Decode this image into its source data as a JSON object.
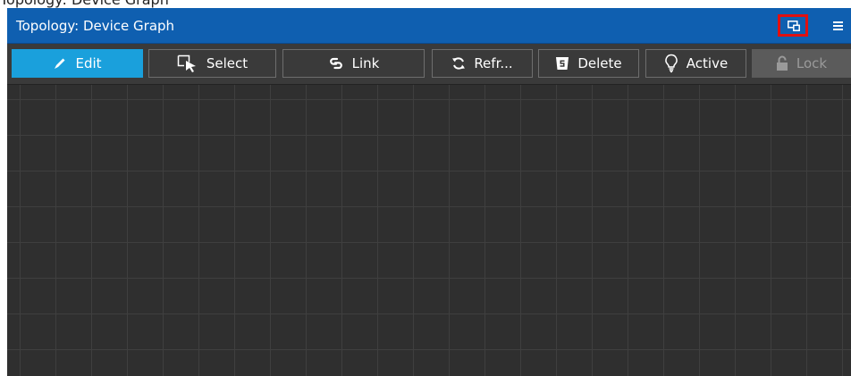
{
  "page": {
    "heading": "Topology: Device Graph"
  },
  "window": {
    "title": "Topology: Device Graph",
    "header_icons": [
      "popout-window-icon",
      "hamburger-menu-icon"
    ]
  },
  "toolbar": {
    "edit_label": "Edit",
    "select_label": "Select",
    "link_label": "Link",
    "refresh_label": "Refr...",
    "delete_label": "Delete",
    "active_label": "Active",
    "lock_label": "Lock",
    "active_tool": "Edit",
    "disabled_tools": [
      "Lock"
    ]
  },
  "colors": {
    "header_blue": "#0f5fb0",
    "active_button": "#1aa0dc",
    "toolbar_bg": "#3a3a3a",
    "canvas_bg": "#2f2f2f",
    "highlight_red": "#e01010"
  }
}
